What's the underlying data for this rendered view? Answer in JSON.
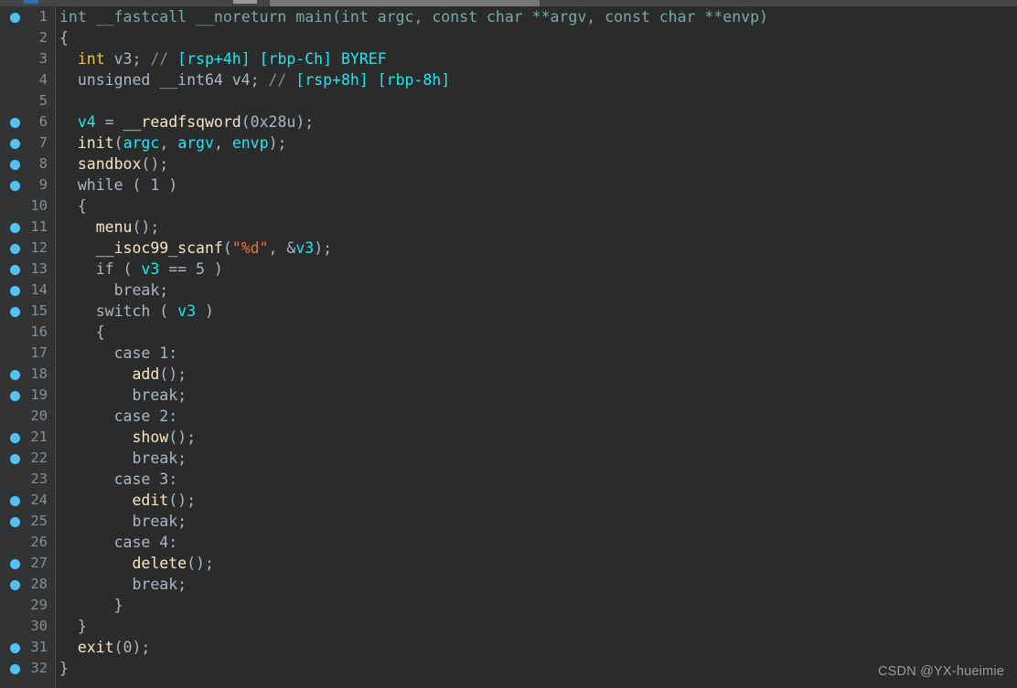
{
  "window": {
    "chrome_strip_present": true,
    "active_tab_indicator_color": "#2f6fb5",
    "toolbar_light_color": "#787878"
  },
  "editor": {
    "name": "ida-pseudocode-view",
    "background": "#2b2b2b",
    "gutter_background": "#313335",
    "breakpoint_color": "#4fc3f7",
    "line_number_color": "#888e91",
    "default_text_color": "#a9b7c6",
    "first_line": 1,
    "last_line": 32,
    "lines": [
      {
        "n": "1",
        "bp": true,
        "text": "int __fastcall __noreturn main(int argc, const char **argv, const char **envp)"
      },
      {
        "n": "2",
        "bp": false,
        "text": "{"
      },
      {
        "n": "3",
        "bp": false,
        "text": "  int v3; // [rsp+4h] [rbp-Ch] BYREF"
      },
      {
        "n": "4",
        "bp": false,
        "text": "  unsigned __int64 v4; // [rsp+8h] [rbp-8h]"
      },
      {
        "n": "5",
        "bp": false,
        "text": ""
      },
      {
        "n": "6",
        "bp": true,
        "text": "  v4 = __readfsqword(0x28u);"
      },
      {
        "n": "7",
        "bp": true,
        "text": "  init(argc, argv, envp);"
      },
      {
        "n": "8",
        "bp": true,
        "text": "  sandbox();"
      },
      {
        "n": "9",
        "bp": true,
        "text": "  while ( 1 )"
      },
      {
        "n": "10",
        "bp": false,
        "text": "  {"
      },
      {
        "n": "11",
        "bp": true,
        "text": "    menu();"
      },
      {
        "n": "12",
        "bp": true,
        "text": "    __isoc99_scanf(\"%d\", &v3);"
      },
      {
        "n": "13",
        "bp": true,
        "text": "    if ( v3 == 5 )"
      },
      {
        "n": "14",
        "bp": true,
        "text": "      break;"
      },
      {
        "n": "15",
        "bp": true,
        "text": "    switch ( v3 )"
      },
      {
        "n": "16",
        "bp": false,
        "text": "    {"
      },
      {
        "n": "17",
        "bp": false,
        "text": "      case 1:"
      },
      {
        "n": "18",
        "bp": true,
        "text": "        add();"
      },
      {
        "n": "19",
        "bp": true,
        "text": "        break;"
      },
      {
        "n": "20",
        "bp": false,
        "text": "      case 2:"
      },
      {
        "n": "21",
        "bp": true,
        "text": "        show();"
      },
      {
        "n": "22",
        "bp": true,
        "text": "        break;"
      },
      {
        "n": "23",
        "bp": false,
        "text": "      case 3:"
      },
      {
        "n": "24",
        "bp": true,
        "text": "        edit();"
      },
      {
        "n": "25",
        "bp": true,
        "text": "        break;"
      },
      {
        "n": "26",
        "bp": false,
        "text": "      case 4:"
      },
      {
        "n": "27",
        "bp": true,
        "text": "        delete();"
      },
      {
        "n": "28",
        "bp": true,
        "text": "        break;"
      },
      {
        "n": "29",
        "bp": false,
        "text": "      }"
      },
      {
        "n": "30",
        "bp": false,
        "text": "  }"
      },
      {
        "n": "31",
        "bp": true,
        "text": "  exit(0);"
      },
      {
        "n": "32",
        "bp": true,
        "text": "}"
      }
    ],
    "tokens": [
      [
        [
          "int ",
          "t-sig"
        ],
        [
          "__fastcall ",
          "t-sig"
        ],
        [
          "__noreturn ",
          "t-sig"
        ],
        [
          "main",
          "t-sig"
        ],
        [
          "(",
          "t-sig"
        ],
        [
          "int ",
          "t-sig"
        ],
        [
          "argc",
          "t-sig"
        ],
        [
          ", ",
          "t-sig"
        ],
        [
          "const ",
          "t-sig"
        ],
        [
          "char ",
          "t-sig"
        ],
        [
          "**argv",
          "t-sig"
        ],
        [
          ", ",
          "t-sig"
        ],
        [
          "const ",
          "t-sig"
        ],
        [
          "char ",
          "t-sig"
        ],
        [
          "**envp",
          "t-sig"
        ],
        [
          ")",
          "t-sig"
        ]
      ],
      [
        [
          "{",
          "t-punc"
        ]
      ],
      [
        [
          "  ",
          "t-plain"
        ],
        [
          "int",
          "t-type"
        ],
        [
          " v3; ",
          "t-plain"
        ],
        [
          "//",
          "t-comment"
        ],
        [
          " ",
          "t-plain"
        ],
        [
          "[rsp+4h] [rbp-Ch] BYREF",
          "t-cmtval"
        ]
      ],
      [
        [
          "  unsigned __int64 v4; ",
          "t-plain"
        ],
        [
          "//",
          "t-comment"
        ],
        [
          " ",
          "t-plain"
        ],
        [
          "[rsp+8h] [rbp-8h]",
          "t-cmtval"
        ]
      ],
      [
        [
          "",
          "t-plain"
        ]
      ],
      [
        [
          "  ",
          "t-plain"
        ],
        [
          "v4",
          "t-var"
        ],
        [
          " = ",
          "t-plain"
        ],
        [
          "__readfsqword",
          "t-fn"
        ],
        [
          "(",
          "t-punc"
        ],
        [
          "0x28u",
          "t-plain"
        ],
        [
          ");",
          "t-punc"
        ]
      ],
      [
        [
          "  ",
          "t-plain"
        ],
        [
          "init",
          "t-fn"
        ],
        [
          "(",
          "t-punc"
        ],
        [
          "argc",
          "t-var"
        ],
        [
          ", ",
          "t-punc"
        ],
        [
          "argv",
          "t-var"
        ],
        [
          ", ",
          "t-punc"
        ],
        [
          "envp",
          "t-var"
        ],
        [
          ");",
          "t-punc"
        ]
      ],
      [
        [
          "  ",
          "t-plain"
        ],
        [
          "sandbox",
          "t-fn"
        ],
        [
          "();",
          "t-punc"
        ]
      ],
      [
        [
          "  while ( 1 )",
          "t-plain"
        ]
      ],
      [
        [
          "  {",
          "t-punc"
        ]
      ],
      [
        [
          "    ",
          "t-plain"
        ],
        [
          "menu",
          "t-fn"
        ],
        [
          "();",
          "t-punc"
        ]
      ],
      [
        [
          "    ",
          "t-plain"
        ],
        [
          "__isoc99_scanf",
          "t-fn"
        ],
        [
          "(",
          "t-punc"
        ],
        [
          "\"%d\"",
          "t-string"
        ],
        [
          ", &",
          "t-punc"
        ],
        [
          "v3",
          "t-var"
        ],
        [
          ");",
          "t-punc"
        ]
      ],
      [
        [
          "    if ( ",
          "t-plain"
        ],
        [
          "v3",
          "t-var"
        ],
        [
          " == 5 )",
          "t-plain"
        ]
      ],
      [
        [
          "      break;",
          "t-plain"
        ]
      ],
      [
        [
          "    switch ( ",
          "t-plain"
        ],
        [
          "v3",
          "t-var"
        ],
        [
          " )",
          "t-plain"
        ]
      ],
      [
        [
          "    {",
          "t-punc"
        ]
      ],
      [
        [
          "      case 1:",
          "t-plain"
        ]
      ],
      [
        [
          "        ",
          "t-plain"
        ],
        [
          "add",
          "t-fn"
        ],
        [
          "();",
          "t-punc"
        ]
      ],
      [
        [
          "        break;",
          "t-plain"
        ]
      ],
      [
        [
          "      case 2:",
          "t-plain"
        ]
      ],
      [
        [
          "        ",
          "t-plain"
        ],
        [
          "show",
          "t-fn"
        ],
        [
          "();",
          "t-punc"
        ]
      ],
      [
        [
          "        break;",
          "t-plain"
        ]
      ],
      [
        [
          "      case 3:",
          "t-plain"
        ]
      ],
      [
        [
          "        ",
          "t-plain"
        ],
        [
          "edit",
          "t-fn"
        ],
        [
          "();",
          "t-punc"
        ]
      ],
      [
        [
          "        break;",
          "t-plain"
        ]
      ],
      [
        [
          "      case 4:",
          "t-plain"
        ]
      ],
      [
        [
          "        ",
          "t-plain"
        ],
        [
          "delete",
          "t-fn"
        ],
        [
          "();",
          "t-punc"
        ]
      ],
      [
        [
          "        break;",
          "t-plain"
        ]
      ],
      [
        [
          "      }",
          "t-punc"
        ]
      ],
      [
        [
          "  }",
          "t-punc"
        ]
      ],
      [
        [
          "  ",
          "t-plain"
        ],
        [
          "exit",
          "t-fn"
        ],
        [
          "(0);",
          "t-punc"
        ]
      ],
      [
        [
          "}",
          "t-punc"
        ]
      ]
    ]
  },
  "watermark": {
    "text": "CSDN @YX-hueimie"
  }
}
